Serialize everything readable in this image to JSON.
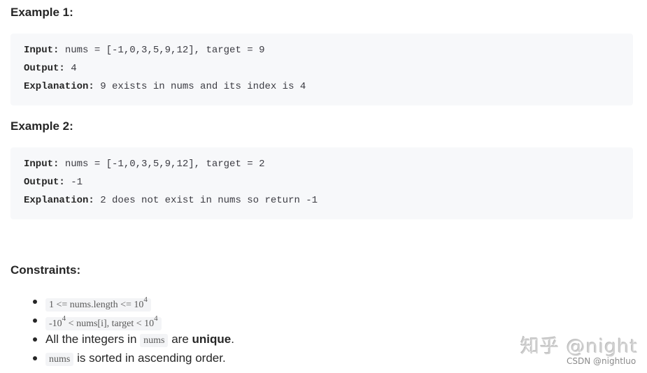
{
  "examples": [
    {
      "title": "Example 1:",
      "input_label": "Input:",
      "input_value": " nums = [-1,0,3,5,9,12], target = 9",
      "output_label": "Output:",
      "output_value": " 4",
      "explanation_label": "Explanation:",
      "explanation_value": " 9 exists in nums and its index is 4"
    },
    {
      "title": "Example 2:",
      "input_label": "Input:",
      "input_value": " nums = [-1,0,3,5,9,12], target = 2",
      "output_label": "Output:",
      "output_value": " -1",
      "explanation_label": "Explanation:",
      "explanation_value": " 2 does not exist in nums so return -1"
    }
  ],
  "constraints": {
    "title": "Constraints:",
    "items": [
      {
        "code_a": "1 <= nums.length <= 10",
        "sup_a": "4"
      },
      {
        "code_pre": "-10",
        "sup_pre": "4",
        "code_mid": " < nums[i], target < 10",
        "sup_post": "4"
      },
      {
        "text_a": "All the integers in ",
        "code": "nums",
        "text_b": " are ",
        "bold": "unique",
        "text_c": "."
      },
      {
        "code": "nums",
        "text": " is sorted in ascending order."
      }
    ]
  },
  "watermark": {
    "main": "知乎 @night",
    "credit": "CSDN @nightluo"
  }
}
